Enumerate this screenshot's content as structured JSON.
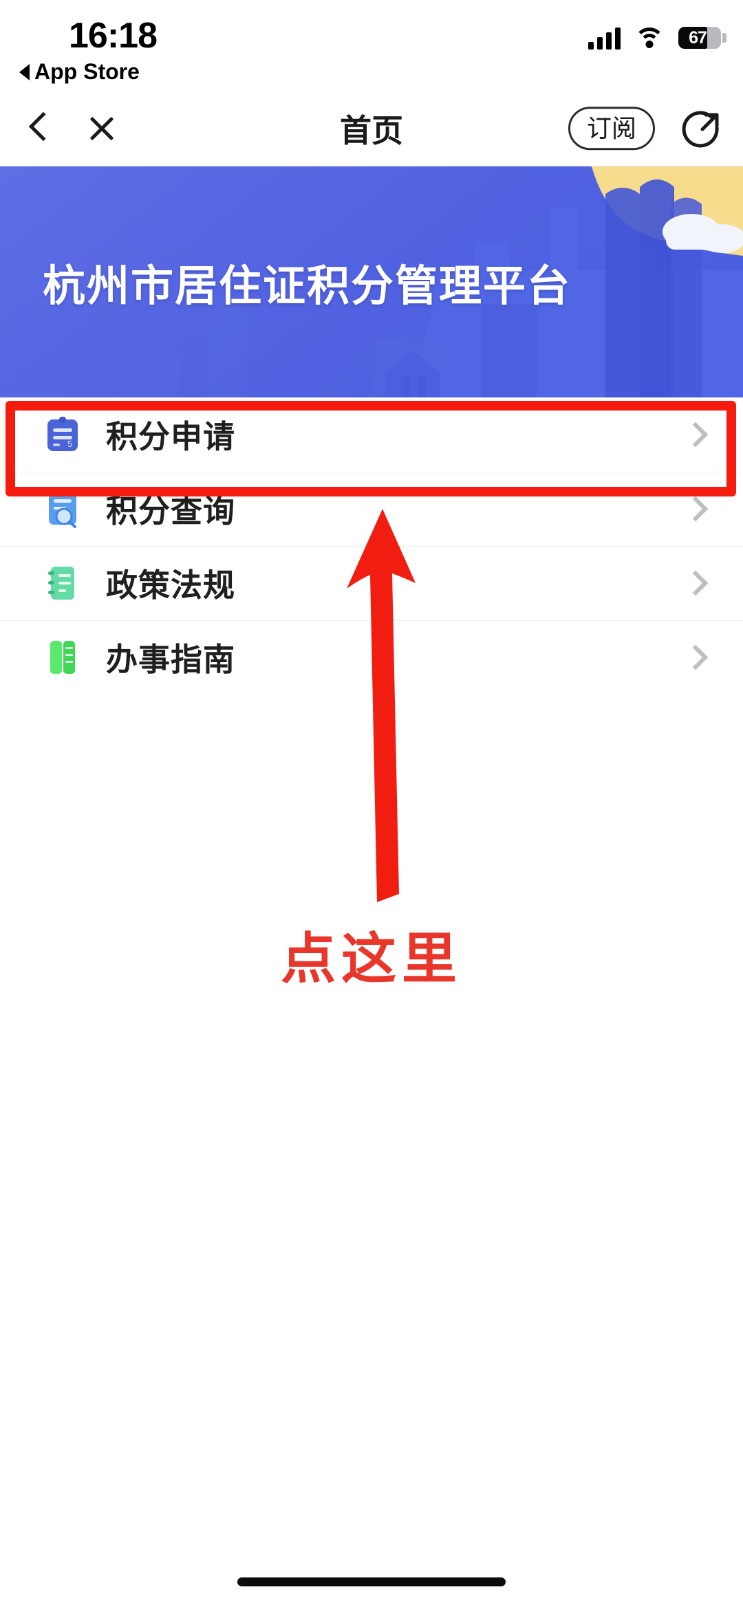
{
  "status_bar": {
    "time": "16:18",
    "return_app_label": "App Store",
    "signal_icon": "cellular-signal-icon",
    "wifi_icon": "wifi-icon",
    "battery_percent": "67",
    "battery_level": 67
  },
  "nav_bar": {
    "back_icon": "chevron-left-icon",
    "close_icon": "close-icon",
    "title": "首页",
    "subscribe_label": "订阅",
    "share_icon": "share-icon"
  },
  "banner": {
    "title": "杭州市居住证积分管理平台",
    "bg_color_left": "#5b6ae2",
    "bg_color_right": "#4a5fe0",
    "sun_color": "#f6dc8c",
    "cloud_color": "#f2f4fb",
    "building_color": "#3f54d6"
  },
  "menu": {
    "items": [
      {
        "label": "积分申请",
        "icon": "clipboard-icon",
        "icon_color": "#4a63d8",
        "chevron": "chevron-right-icon"
      },
      {
        "label": "积分查询",
        "icon": "document-search-icon",
        "icon_color": "#5a9cf0",
        "chevron": "chevron-right-icon"
      },
      {
        "label": "政策法规",
        "icon": "notebook-icon",
        "icon_color": "#64dba4",
        "chevron": "chevron-right-icon"
      },
      {
        "label": "办事指南",
        "icon": "book-icon",
        "icon_color": "#4cdd62",
        "chevron": "chevron-right-icon"
      }
    ]
  },
  "annotation": {
    "highlight_color": "#f51b0f",
    "arrow_color": "#f01d10",
    "callout_text": "点这里",
    "callout_color": "#e8372a",
    "target_item": "积分申请"
  },
  "home_indicator": {
    "color": "#0b0b0b"
  }
}
